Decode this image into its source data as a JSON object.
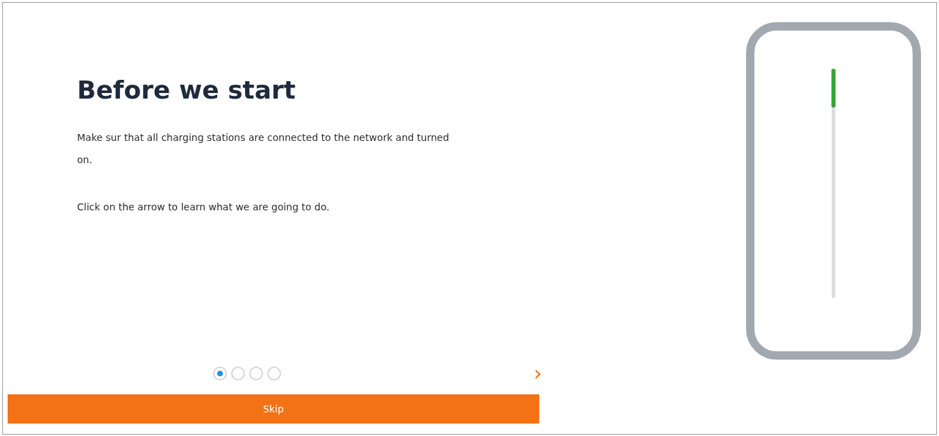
{
  "title": "Before we start",
  "paragraphs": [
    "Make sur that all charging stations are connected to the network and turned on.",
    "Click on the arrow to learn what we are going to do."
  ],
  "steps": [
    {
      "selected": true
    },
    {
      "selected": false
    },
    {
      "selected": false
    },
    {
      "selected": false
    }
  ],
  "next_button": {
    "label": "›"
  },
  "skip_button": {
    "label": "Skip"
  }
}
